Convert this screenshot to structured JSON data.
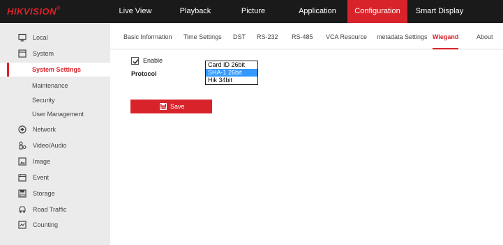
{
  "brand": {
    "logo_text_red": "HIK",
    "logo_text_white": "VISION",
    "logo_reg": "®"
  },
  "topnav": {
    "items": [
      {
        "label": "Live View"
      },
      {
        "label": "Playback"
      },
      {
        "label": "Picture"
      },
      {
        "label": "Application"
      },
      {
        "label": "Configuration",
        "active": true
      },
      {
        "label": "Smart Display"
      }
    ]
  },
  "sidebar": {
    "items": [
      {
        "label": "Local",
        "icon": "monitor-icon"
      },
      {
        "label": "System",
        "icon": "system-icon"
      },
      {
        "label": "System Settings",
        "active": true
      },
      {
        "label": "Maintenance"
      },
      {
        "label": "Security"
      },
      {
        "label": "User Management"
      },
      {
        "label": "Network",
        "icon": "network-icon"
      },
      {
        "label": "Video/Audio",
        "icon": "video-audio-icon"
      },
      {
        "label": "Image",
        "icon": "image-icon"
      },
      {
        "label": "Event",
        "icon": "event-icon"
      },
      {
        "label": "Storage",
        "icon": "storage-icon"
      },
      {
        "label": "Road Traffic",
        "icon": "road-traffic-icon"
      },
      {
        "label": "Counting",
        "icon": "counting-icon"
      }
    ]
  },
  "tabs": {
    "items": [
      {
        "label": "Basic Information"
      },
      {
        "label": "Time Settings"
      },
      {
        "label": "DST"
      },
      {
        "label": "RS-232"
      },
      {
        "label": "RS-485"
      },
      {
        "label": "VCA Resource"
      },
      {
        "label": "metadata Settings"
      },
      {
        "label": "Wiegand",
        "active": true
      },
      {
        "label": "About"
      }
    ]
  },
  "form": {
    "enable_label": "Enable",
    "enable_checked": true,
    "protocol_label": "Protocol",
    "protocol_options": [
      "Card ID 26bit",
      "SHA-1 26bit",
      "Hik 34bit"
    ],
    "protocol_selected": "SHA-1 26bit",
    "save_label": "Save"
  },
  "colors": {
    "accent": "#d8232a",
    "topbar": "#1a1a1a",
    "selection": "#3399ff",
    "sidebar_bg": "#ebebeb"
  }
}
